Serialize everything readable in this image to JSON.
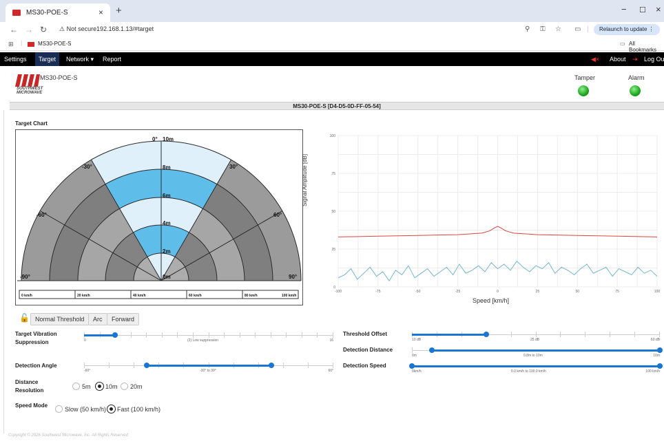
{
  "browser": {
    "tab_title": "MS30-POE-S",
    "not_secure": "Not secure",
    "url": "192.168.1.13/#target",
    "relaunch": "Relaunch to update",
    "bookmark": "MS30-POE-S",
    "all_bookmarks": "All Bookmarks"
  },
  "nav": {
    "items": [
      "Settings",
      "Target",
      "Network",
      "Report"
    ],
    "network_caret": "▾",
    "about": "About",
    "logout": "Log Out"
  },
  "header": {
    "brand": "SOUTHWEST MICROWAVE",
    "device_name": "MS30-POE-S",
    "tamper": "Tamper",
    "alarm": "Alarm"
  },
  "device_bar": "MS30-POE-S [D4-D5-0D-FF-05-54]",
  "target_chart_title": "Target Chart",
  "radar": {
    "angle_labels": [
      "-90°",
      "-60°",
      "-30°",
      "0°",
      "30°",
      "60°",
      "90°"
    ],
    "range_labels": [
      "10m",
      "8m",
      "6m",
      "4m",
      "2m",
      "0m"
    ],
    "speed_labels": [
      "0 km/h",
      "20 km/h",
      "40 km/h",
      "60 km/h",
      "80 km/h",
      "100 km/h"
    ]
  },
  "chart_data": {
    "type": "line",
    "xlabel": "Speed [km/h]",
    "ylabel": "Signal Amplitude [dB]",
    "xlim": [
      -100,
      100
    ],
    "ylim": [
      0,
      100
    ],
    "x_ticks": [
      -100,
      -75,
      -50,
      -25,
      0,
      25,
      50,
      75,
      100
    ],
    "y_ticks": [
      0,
      25,
      50,
      75,
      100
    ],
    "grid": true,
    "series": [
      {
        "color": "#d9443f",
        "x": [
          -100,
          -75,
          -50,
          -25,
          -10,
          -5,
          -2,
          0,
          2,
          5,
          10,
          25,
          50,
          75,
          100
        ],
        "y": [
          33,
          33.5,
          34,
          34.5,
          35.5,
          37,
          39,
          40,
          39,
          37,
          35.5,
          34.5,
          34,
          33.5,
          33
        ]
      },
      {
        "color": "#74b5cc",
        "x": [
          -100,
          -96,
          -92,
          -88,
          -84,
          -80,
          -76,
          -72,
          -68,
          -64,
          -60,
          -56,
          -52,
          -48,
          -44,
          -40,
          -36,
          -32,
          -28,
          -24,
          -20,
          -16,
          -12,
          -8,
          -4,
          0,
          4,
          8,
          12,
          16,
          20,
          24,
          28,
          32,
          36,
          40,
          44,
          48,
          52,
          56,
          60,
          64,
          68,
          72,
          76,
          80,
          84,
          88,
          92,
          96,
          100
        ],
        "y": [
          6,
          8,
          12,
          5,
          9,
          13,
          7,
          10,
          4,
          11,
          8,
          14,
          6,
          9,
          12,
          7,
          10,
          13,
          8,
          15,
          9,
          11,
          14,
          10,
          16,
          12,
          15,
          11,
          17,
          13,
          10,
          14,
          12,
          16,
          9,
          13,
          11,
          8,
          12,
          15,
          9,
          11,
          13,
          7,
          12,
          10,
          8,
          13,
          9,
          11,
          7
        ]
      }
    ]
  },
  "controls": {
    "mode_buttons": [
      "Normal Threshold",
      "Arc",
      "Forward"
    ],
    "vibration": {
      "label": "Target Vibration Suppression",
      "min": "0",
      "max": "16",
      "value_text": "(2) Low suppression",
      "value": 2
    },
    "angle": {
      "label": "Detection Angle",
      "min": "-60°",
      "max": "60°",
      "value_text": "-30° to 30°",
      "low": -30,
      "high": 30
    },
    "resolution": {
      "label": "Distance Resolution",
      "options": [
        "5m",
        "10m",
        "20m"
      ],
      "selected": "10m"
    },
    "speed_mode": {
      "label": "Speed Mode",
      "options": [
        "Slow (50 km/h)",
        "Fast (100 km/h)"
      ],
      "selected": "Fast (100 km/h)"
    },
    "threshold": {
      "label": "Threshold Offset",
      "min": "10 dB",
      "mid": "25 dB",
      "max": "60 dB",
      "value": 25
    },
    "distance": {
      "label": "Detection Distance",
      "min": "0m",
      "max": "10m",
      "value_text": "0.8m to 10m",
      "low": 0.8,
      "high": 10
    },
    "speed": {
      "label": "Detection Speed",
      "min": "0km/h",
      "max": "100 km/h",
      "value_text": "0.0 km/h to 100.0 km/h",
      "low": 0,
      "high": 100
    }
  },
  "footer": "Copyright © 2026 Southwest Microwave, Inc. All Rights Reserved"
}
